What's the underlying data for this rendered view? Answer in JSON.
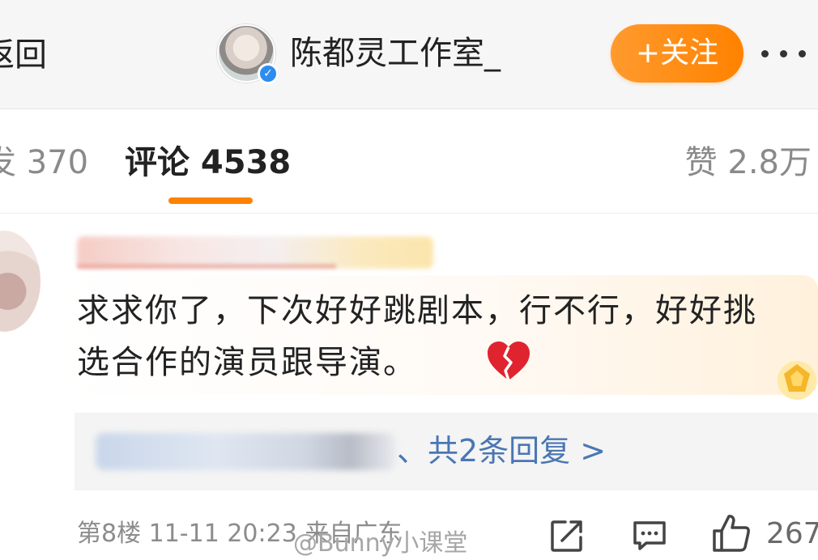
{
  "header": {
    "back_label": "返回",
    "account_name": "陈都灵工作室_",
    "follow_label": "+关注",
    "verified_mark": "✓"
  },
  "tabs": {
    "reposts": "发 370",
    "comments": "评论 4538",
    "likes": "赞 2.8万"
  },
  "comment": {
    "text": "求求你了，下次好好跳剧本，行不行，好好挑选合作的演员跟导演。",
    "emoji_icon": "broken-heart-icon",
    "replies_link": "、共2条回复 >",
    "meta": "第8楼 11-11 20:23 来自广东",
    "like_count": "267"
  },
  "watermark": "@Bunny小课堂",
  "colors": {
    "accent": "#ff8200",
    "link": "#4a76b4",
    "verified": "#2d8cf0",
    "muted_text": "#8c8c8c"
  }
}
